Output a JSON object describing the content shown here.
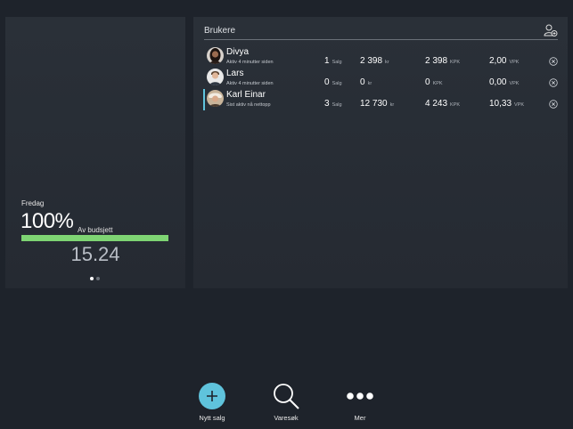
{
  "summary": {
    "day": "Fredag",
    "percent": "100%",
    "budget_label": "Av budsjett",
    "progress": 1.0,
    "total": "15.24",
    "page_dots": 2,
    "active_dot": 0
  },
  "users": {
    "title": "Brukere",
    "rows": [
      {
        "name": "Divya",
        "status": "Aktiv 4 minutter siden",
        "sales": "1",
        "sales_unit": "Salg",
        "amount": "2 398",
        "amount_unit": "kr",
        "kpk": "2 398",
        "kpk_unit": "KPK",
        "vpk": "2,00",
        "vpk_unit": "VPK",
        "selected": false
      },
      {
        "name": "Lars",
        "status": "Aktiv 4 minutter siden",
        "sales": "0",
        "sales_unit": "Salg",
        "amount": "0",
        "amount_unit": "kr",
        "kpk": "0",
        "kpk_unit": "KPK",
        "vpk": "0,00",
        "vpk_unit": "VPK",
        "selected": false
      },
      {
        "name": "Karl Einar",
        "status": "Sist aktiv nå nettopp",
        "sales": "3",
        "sales_unit": "Salg",
        "amount": "12 730",
        "amount_unit": "kr",
        "kpk": "4 243",
        "kpk_unit": "KPK",
        "vpk": "10,33",
        "vpk_unit": "VPK",
        "selected": true
      }
    ]
  },
  "bottom_nav": {
    "new_sale": "Nytt salg",
    "search": "Varesøk",
    "more": "Mer"
  },
  "colors": {
    "background": "#1e232b",
    "panel": "#272c34",
    "accent": "#5fc3dc",
    "progress": "#7ed473"
  },
  "icons": {
    "add_user": "add-user-icon",
    "remove": "close-circle-icon",
    "new_sale": "plus-circle-icon",
    "search": "magnifier-icon",
    "more": "ellipsis-icon"
  }
}
